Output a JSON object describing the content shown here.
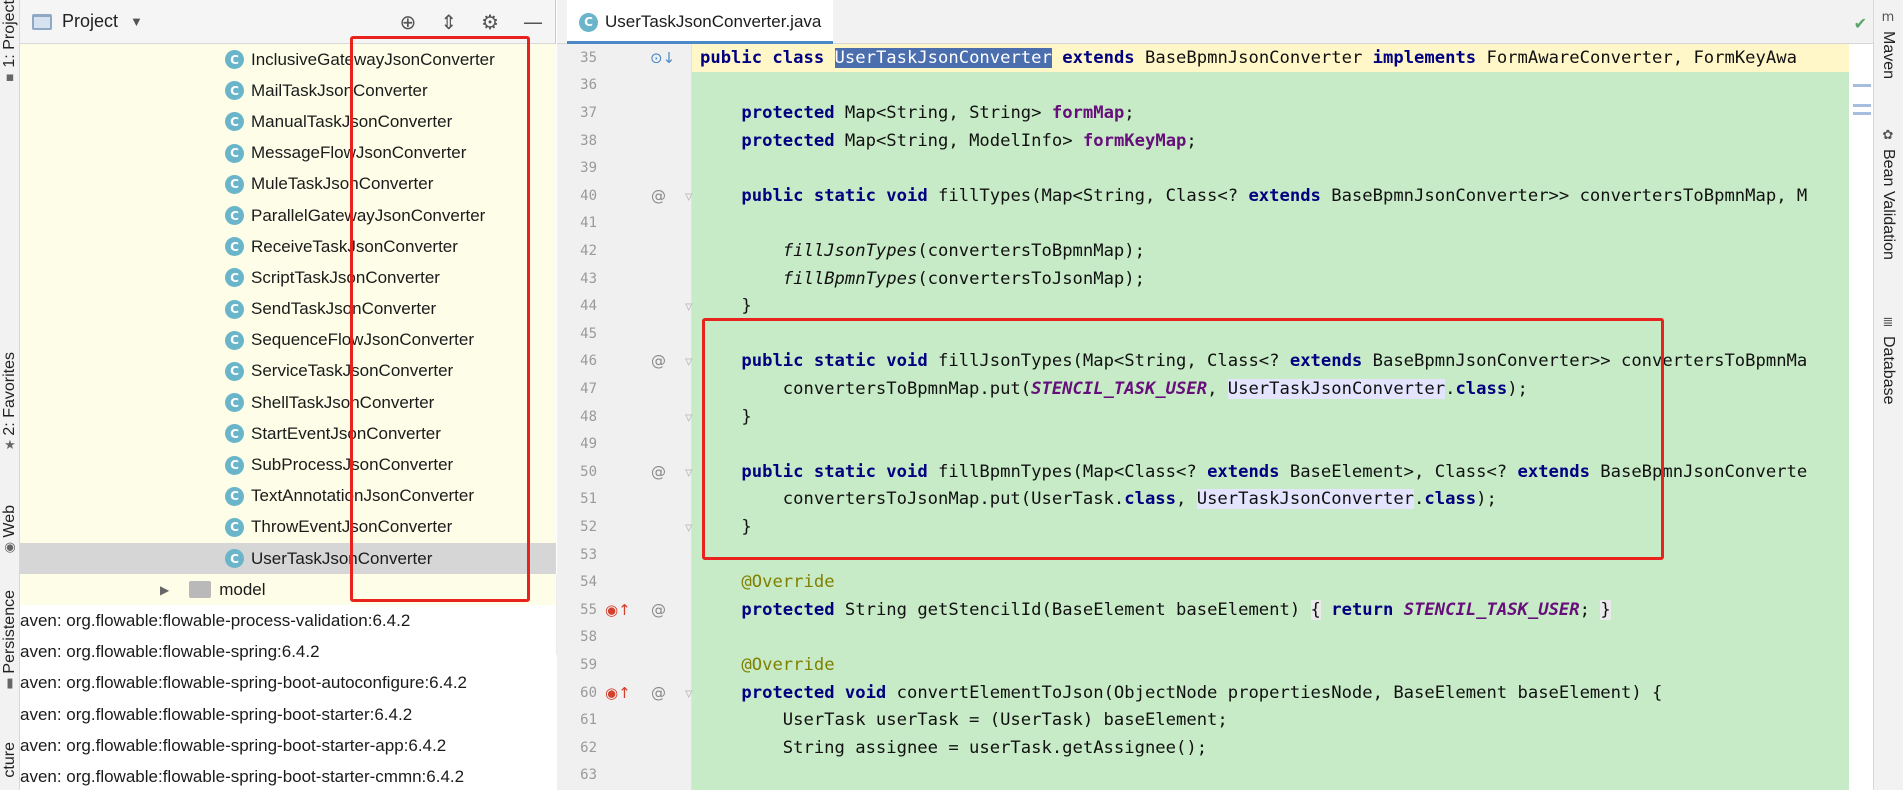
{
  "left_strip": {
    "tabs": [
      {
        "label": "1: Project"
      },
      {
        "label": "2: Favorites"
      },
      {
        "label": "Web"
      },
      {
        "label": "Persistence"
      },
      {
        "label": "cture"
      }
    ]
  },
  "project_panel": {
    "title": "Project",
    "classes": [
      "InclusiveGatewayJsonConverter",
      "MailTaskJsonConverter",
      "ManualTaskJsonConverter",
      "MessageFlowJsonConverter",
      "MuleTaskJsonConverter",
      "ParallelGatewayJsonConverter",
      "ReceiveTaskJsonConverter",
      "ScriptTaskJsonConverter",
      "SendTaskJsonConverter",
      "SequenceFlowJsonConverter",
      "ServiceTaskJsonConverter",
      "ShellTaskJsonConverter",
      "StartEventJsonConverter",
      "SubProcessJsonConverter",
      "TextAnnotationJsonConverter",
      "ThrowEventJsonConverter",
      "UserTaskJsonConverter"
    ],
    "selected_class": "UserTaskJsonConverter",
    "folder": "model",
    "libraries": [
      "aven: org.flowable:flowable-process-validation:6.4.2",
      "aven: org.flowable:flowable-spring:6.4.2",
      "aven: org.flowable:flowable-spring-boot-autoconfigure:6.4.2",
      "aven: org.flowable:flowable-spring-boot-starter:6.4.2",
      "aven: org.flowable:flowable-spring-boot-starter-app:6.4.2",
      "aven: org.flowable:flowable-spring-boot-starter-cmmn:6.4.2"
    ]
  },
  "editor": {
    "tab_label": "UserTaskJsonConverter.java",
    "line_numbers": [
      "35",
      "36",
      "37",
      "38",
      "39",
      "40",
      "41",
      "42",
      "43",
      "44",
      "45",
      "46",
      "47",
      "48",
      "49",
      "50",
      "51",
      "52",
      "53",
      "54",
      "55",
      "58",
      "59",
      "60",
      "61",
      "62",
      "63"
    ]
  },
  "right_strip": {
    "tabs": [
      {
        "label": "Maven"
      },
      {
        "label": "Bean Validation"
      },
      {
        "label": "Database"
      }
    ]
  },
  "colors": {
    "highlight_box": "#e8231d",
    "code_bg": "#c7eac7",
    "tree_bg": "#fdfde8"
  }
}
